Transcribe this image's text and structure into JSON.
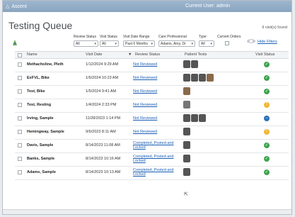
{
  "app": {
    "brand": "Ascent",
    "current_user": "Current User: admin"
  },
  "page": {
    "title": "Testing Queue",
    "visit_count": "9 visit(s) found",
    "hide_filters": "Hide Filters"
  },
  "filters": [
    {
      "label": "Review Status",
      "value": "All"
    },
    {
      "label": "Visit Status",
      "value": "All"
    },
    {
      "label": "Visit Date Range",
      "value": "Past 6 Months"
    },
    {
      "label": "Care Professional",
      "value": "Adams, Amy, Dr"
    },
    {
      "label": "Type",
      "value": "All"
    },
    {
      "label": "Current Orders",
      "value": ""
    }
  ],
  "columns": {
    "name": "Name",
    "visit_date": "Visit Date",
    "review_status": "Review Status",
    "patient_tests": "Patient Tests",
    "visit_status": "Visit Status"
  },
  "rows": [
    {
      "name": "Methacholine, Pleth",
      "date": "1/12/2024 9:29 AM",
      "status": "Not Reviewed",
      "tests": [
        "dark",
        "dark"
      ],
      "visit": "check"
    },
    {
      "name": "ExFVL, Bike",
      "date": "1/6/2024 10:23 AM",
      "status": "Not Reviewed",
      "tests": [
        "dark",
        "dark",
        "dark",
        "heart"
      ],
      "visit": "check"
    },
    {
      "name": "Test, Bike",
      "date": "1/5/2024 9:41 AM",
      "status": "Not Reviewed",
      "tests": [
        "heart"
      ],
      "visit": "check"
    },
    {
      "name": "Test, Resting",
      "date": "1/4/2024 2:33 PM",
      "status": "Not Reviewed",
      "tests": [
        "light"
      ],
      "visit": "warning"
    },
    {
      "name": "Irving, Sample",
      "date": "11/28/2023 1:14 PM",
      "status": "Not Reviewed",
      "tests": [
        "dark",
        "dark",
        "dark"
      ],
      "visit": "minus"
    },
    {
      "name": "Hemingway, Sample",
      "date": "9/6/2023 8:11 AM",
      "status": "Not Reviewed",
      "tests": [
        "dark"
      ],
      "visit": "warning"
    },
    {
      "name": "Davis, Sample",
      "date": "8/14/2023 11:08 AM",
      "status": "Completed, Posted and Locked",
      "tests": [
        "dark"
      ],
      "visit": "check"
    },
    {
      "name": "Banks, Sample",
      "date": "8/14/2023 10:16 AM",
      "status": "Completed, Posted and Locked",
      "tests": [
        "dark"
      ],
      "visit": "check"
    },
    {
      "name": "Adams, Sample",
      "date": "8/14/2023 10:13 AM",
      "status": "Completed, Posted and Locked",
      "tests": [
        "dark"
      ],
      "visit": "check"
    }
  ],
  "colors": {
    "check": "#3fa34d",
    "warning": "#f2b632",
    "minus": "#2e6fb8",
    "link": "#1a5fb4"
  }
}
